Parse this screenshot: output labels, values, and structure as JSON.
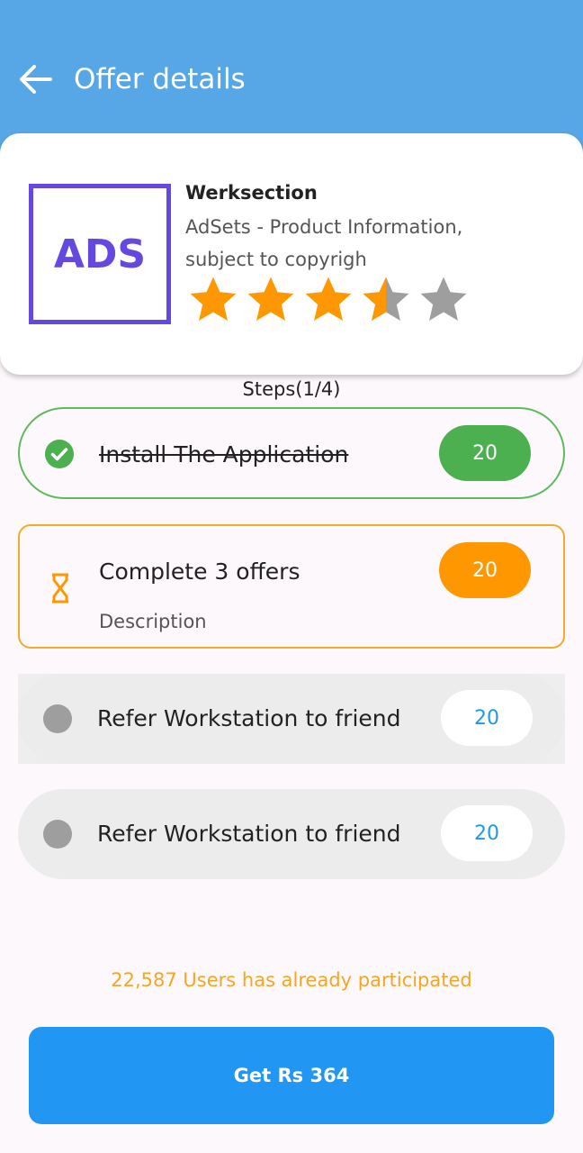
{
  "header": {
    "title": "Offer details",
    "back_icon": "arrow-left-icon",
    "background": "#57a6e6"
  },
  "offer": {
    "logo_text": "ADS",
    "logo_color": "#6448e0",
    "name": "Werksection",
    "description": "AdSets - Product Information, subject to copyrigh",
    "rating": 3.5,
    "rating_max": 5
  },
  "steps": {
    "title": "Steps(1/4)",
    "items": [
      {
        "label": "Install The Application",
        "reward": "20",
        "status": "completed",
        "icon": "check-circle-icon"
      },
      {
        "label": "Complete 3 offers",
        "description": "Description",
        "reward": "20",
        "status": "in-progress",
        "icon": "hourglass-icon"
      },
      {
        "label": "Refer Workstation to friend",
        "reward": "20",
        "status": "pending",
        "icon": "dot-icon"
      },
      {
        "label": "Refer Workstation to friend",
        "reward": "20",
        "status": "pending",
        "icon": "dot-icon"
      }
    ]
  },
  "participation": "22,587 Users has already participated",
  "cta_label": "Get Rs 364",
  "colors": {
    "completed": "#4caf50",
    "in_progress": "#ff9800",
    "primary": "#2196f3",
    "star_filled": "#ff9800",
    "star_empty": "#9e9e9e"
  }
}
